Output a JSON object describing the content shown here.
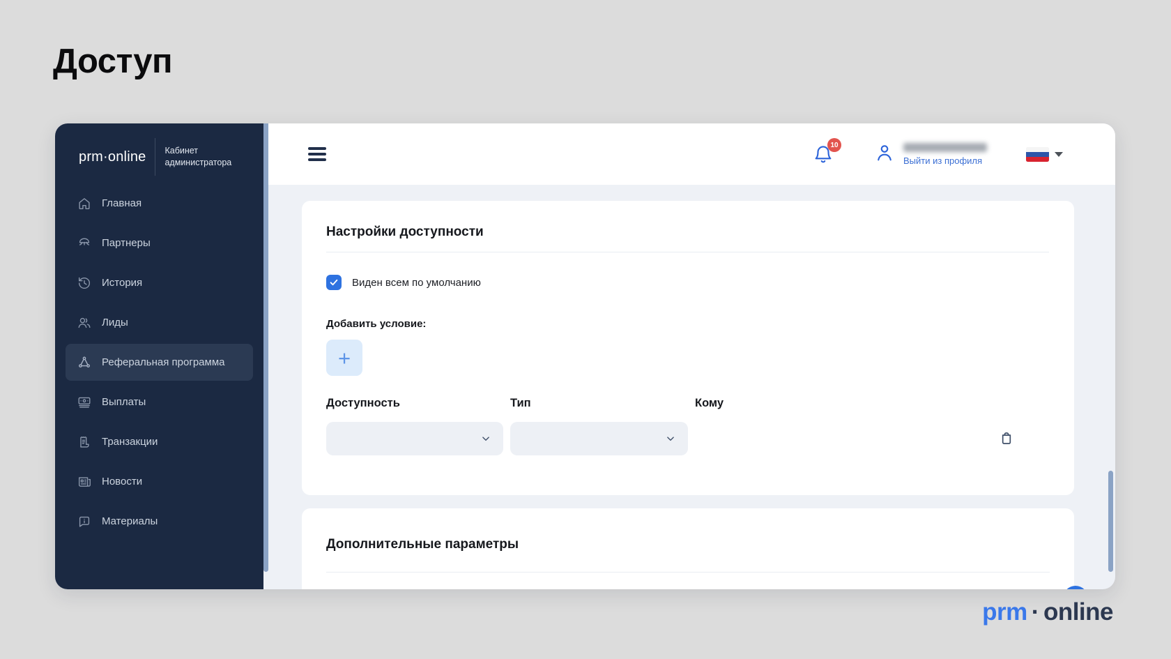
{
  "page_title": "Доступ",
  "sidebar": {
    "brand": {
      "name": "prm·online",
      "caption_line1": "Кабинет",
      "caption_line2": "администратора"
    },
    "items": [
      {
        "label": "Главная",
        "icon": "home-icon",
        "active": false
      },
      {
        "label": "Партнеры",
        "icon": "partners-icon",
        "active": false
      },
      {
        "label": "История",
        "icon": "history-icon",
        "active": false
      },
      {
        "label": "Лиды",
        "icon": "leads-icon",
        "active": false
      },
      {
        "label": "Реферальная программа",
        "icon": "referral-icon",
        "active": true
      },
      {
        "label": "Выплаты",
        "icon": "payouts-icon",
        "active": false
      },
      {
        "label": "Транзакции",
        "icon": "transactions-icon",
        "active": false
      },
      {
        "label": "Новости",
        "icon": "news-icon",
        "active": false
      },
      {
        "label": "Материалы",
        "icon": "materials-icon",
        "active": false
      }
    ]
  },
  "header": {
    "notification_count": "10",
    "user": {
      "name_redacted": true,
      "logout_label": "Выйти из профиля"
    },
    "language": {
      "selected": "ru",
      "flag": "russia-flag"
    }
  },
  "access_card": {
    "title": "Настройки доступности",
    "checkbox": {
      "label": "Виден всем по умолчанию",
      "checked": true
    },
    "add_condition_label": "Добавить условие:",
    "add_button_label": "+",
    "columns": {
      "availability": "Доступность",
      "type": "Тип",
      "whom": "Кому"
    },
    "availability_value": "",
    "type_value": ""
  },
  "additional_card": {
    "title": "Дополнительные параметры"
  },
  "footer_brand": {
    "prm": "prm",
    "dot": "·",
    "online": "online"
  },
  "colors": {
    "accent_blue": "#2e72e0",
    "sidebar_bg": "#1b2942",
    "badge_red": "#e2544e",
    "content_bg": "#eef1f6",
    "flag_stripes": [
      "#f5f5f5",
      "#2d55a9",
      "#d8232f"
    ]
  }
}
